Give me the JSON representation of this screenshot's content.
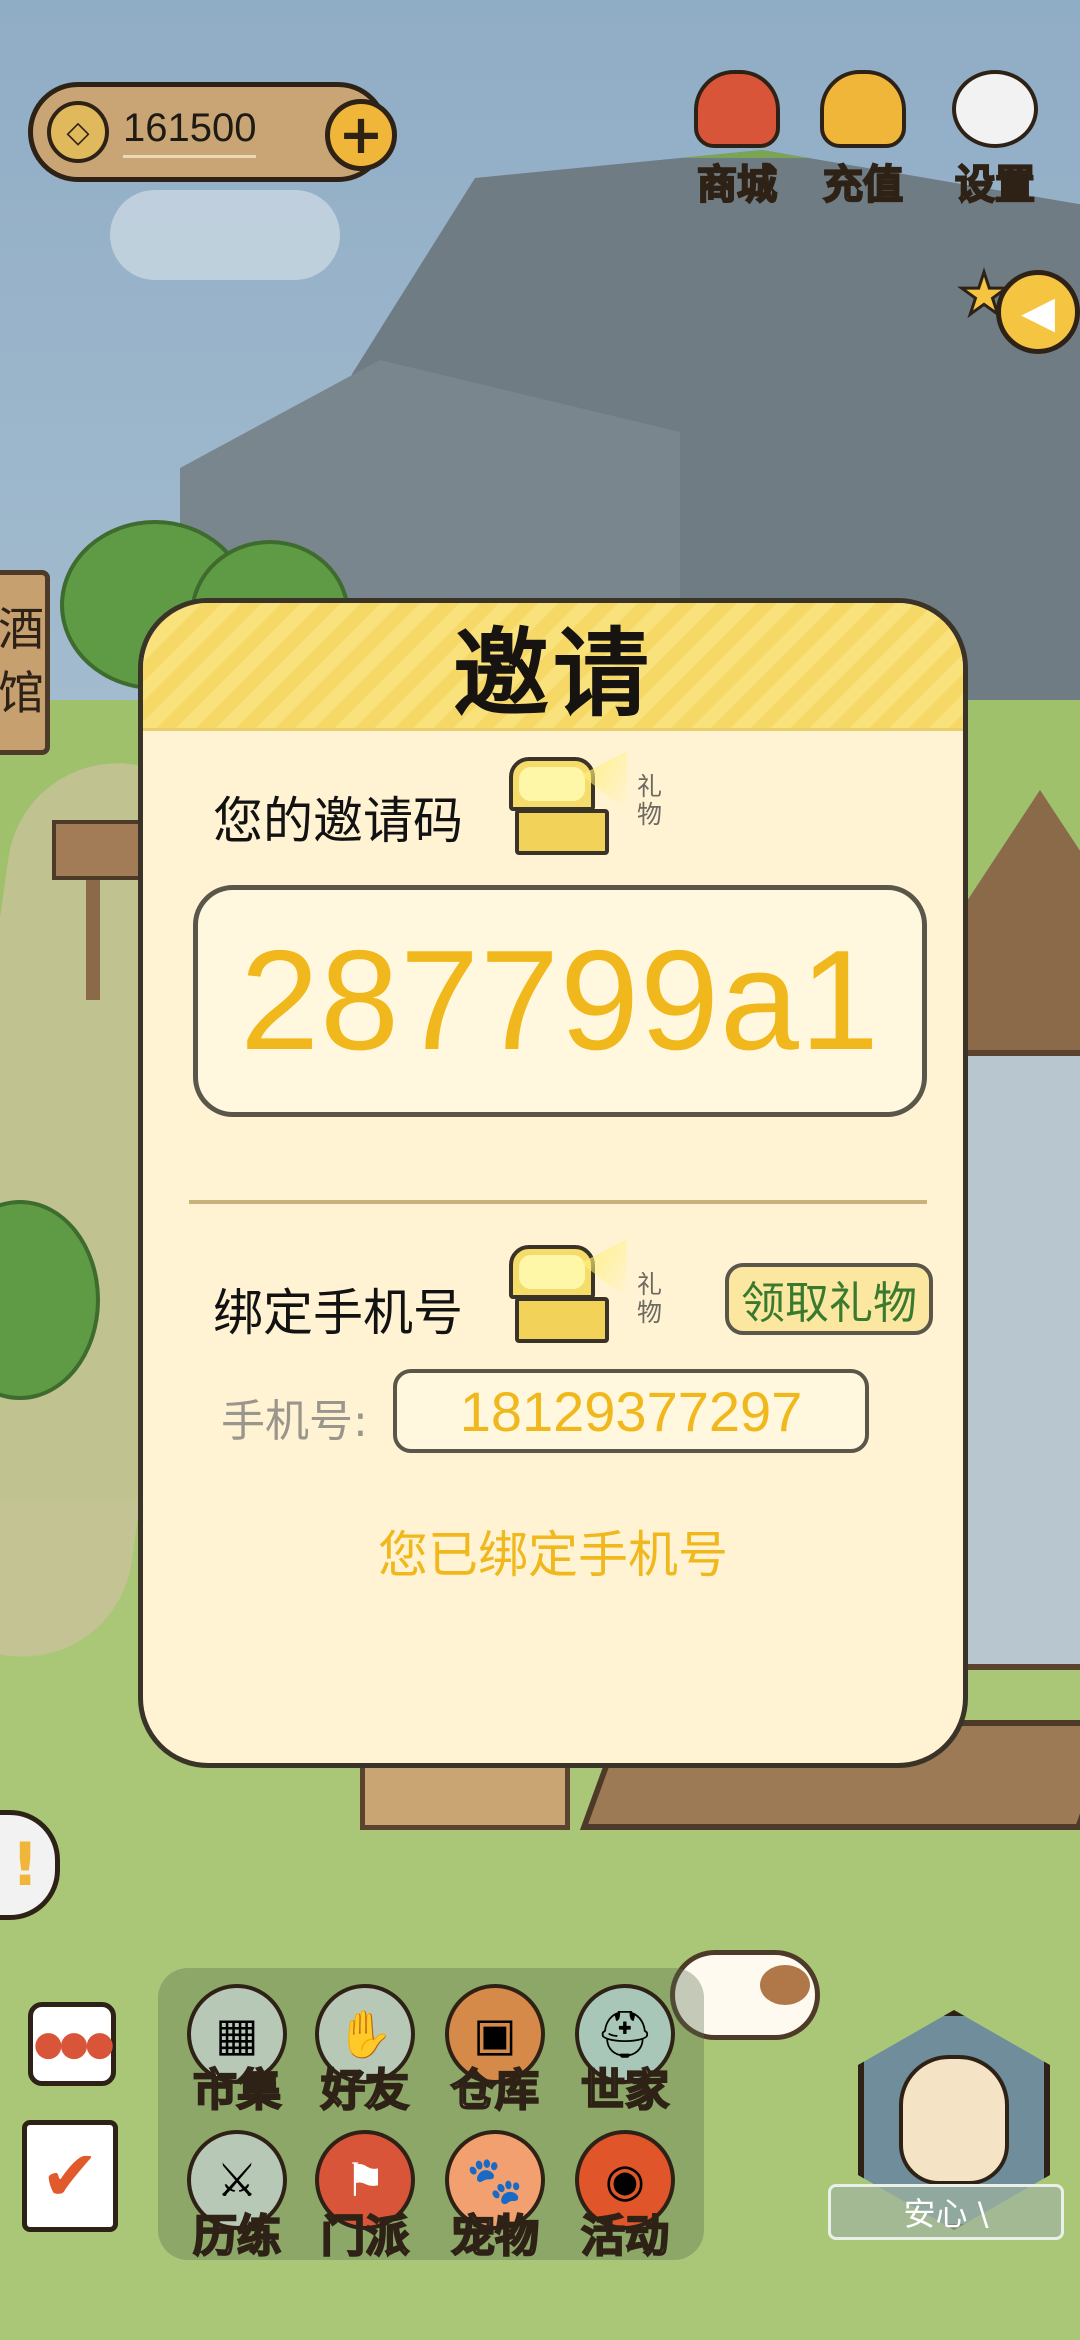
{
  "hud": {
    "coins": "161500",
    "top_buttons": [
      {
        "label": "商城",
        "icon": "shop-bag-icon",
        "color": "#d9553a"
      },
      {
        "label": "充值",
        "icon": "gold-ingot-icon",
        "color": "#f0b63a"
      },
      {
        "label": "设置",
        "icon": "gear-icon",
        "color": "#f2f2f2"
      }
    ],
    "tavern_sign": "酒\n馆"
  },
  "modal": {
    "title": "邀请",
    "invite_label": "您的邀请码",
    "gift_tag": "礼物",
    "invite_code": "287799a1",
    "bind_label": "绑定手机号",
    "claim_button": "领取礼物",
    "phone_label": "手机号:",
    "phone_value": "18129377297",
    "bound_message": "您已绑定手机号"
  },
  "bottom_menu": {
    "items": [
      {
        "label": "市集",
        "icon": "market-shelf-icon"
      },
      {
        "label": "好友",
        "icon": "handshake-icon"
      },
      {
        "label": "仓库",
        "icon": "treasure-chest-icon"
      },
      {
        "label": "世家",
        "icon": "helmet-icon"
      },
      {
        "label": "历练",
        "icon": "crossed-swords-icon"
      },
      {
        "label": "门派",
        "icon": "banner-icon"
      },
      {
        "label": "宠物",
        "icon": "paw-icon"
      },
      {
        "label": "活动",
        "icon": "lantern-icon"
      }
    ]
  },
  "character": {
    "mood": "安心 \\"
  },
  "colors": {
    "accent_gold": "#f0b81c",
    "modal_bg": "#fff3d4",
    "header_yellow": "#f9e27c",
    "claim_green": "#3a7a2e"
  }
}
